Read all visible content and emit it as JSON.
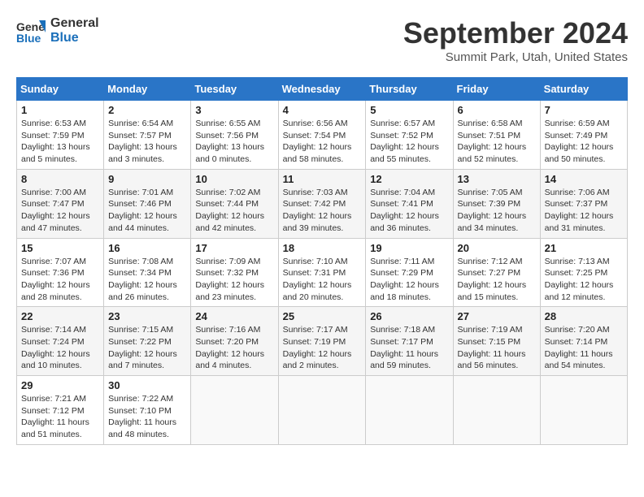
{
  "header": {
    "logo_line1": "General",
    "logo_line2": "Blue",
    "month": "September 2024",
    "location": "Summit Park, Utah, United States"
  },
  "days_of_week": [
    "Sunday",
    "Monday",
    "Tuesday",
    "Wednesday",
    "Thursday",
    "Friday",
    "Saturday"
  ],
  "weeks": [
    [
      {
        "day": "1",
        "info": "Sunrise: 6:53 AM\nSunset: 7:59 PM\nDaylight: 13 hours\nand 5 minutes."
      },
      {
        "day": "2",
        "info": "Sunrise: 6:54 AM\nSunset: 7:57 PM\nDaylight: 13 hours\nand 3 minutes."
      },
      {
        "day": "3",
        "info": "Sunrise: 6:55 AM\nSunset: 7:56 PM\nDaylight: 13 hours\nand 0 minutes."
      },
      {
        "day": "4",
        "info": "Sunrise: 6:56 AM\nSunset: 7:54 PM\nDaylight: 12 hours\nand 58 minutes."
      },
      {
        "day": "5",
        "info": "Sunrise: 6:57 AM\nSunset: 7:52 PM\nDaylight: 12 hours\nand 55 minutes."
      },
      {
        "day": "6",
        "info": "Sunrise: 6:58 AM\nSunset: 7:51 PM\nDaylight: 12 hours\nand 52 minutes."
      },
      {
        "day": "7",
        "info": "Sunrise: 6:59 AM\nSunset: 7:49 PM\nDaylight: 12 hours\nand 50 minutes."
      }
    ],
    [
      {
        "day": "8",
        "info": "Sunrise: 7:00 AM\nSunset: 7:47 PM\nDaylight: 12 hours\nand 47 minutes."
      },
      {
        "day": "9",
        "info": "Sunrise: 7:01 AM\nSunset: 7:46 PM\nDaylight: 12 hours\nand 44 minutes."
      },
      {
        "day": "10",
        "info": "Sunrise: 7:02 AM\nSunset: 7:44 PM\nDaylight: 12 hours\nand 42 minutes."
      },
      {
        "day": "11",
        "info": "Sunrise: 7:03 AM\nSunset: 7:42 PM\nDaylight: 12 hours\nand 39 minutes."
      },
      {
        "day": "12",
        "info": "Sunrise: 7:04 AM\nSunset: 7:41 PM\nDaylight: 12 hours\nand 36 minutes."
      },
      {
        "day": "13",
        "info": "Sunrise: 7:05 AM\nSunset: 7:39 PM\nDaylight: 12 hours\nand 34 minutes."
      },
      {
        "day": "14",
        "info": "Sunrise: 7:06 AM\nSunset: 7:37 PM\nDaylight: 12 hours\nand 31 minutes."
      }
    ],
    [
      {
        "day": "15",
        "info": "Sunrise: 7:07 AM\nSunset: 7:36 PM\nDaylight: 12 hours\nand 28 minutes."
      },
      {
        "day": "16",
        "info": "Sunrise: 7:08 AM\nSunset: 7:34 PM\nDaylight: 12 hours\nand 26 minutes."
      },
      {
        "day": "17",
        "info": "Sunrise: 7:09 AM\nSunset: 7:32 PM\nDaylight: 12 hours\nand 23 minutes."
      },
      {
        "day": "18",
        "info": "Sunrise: 7:10 AM\nSunset: 7:31 PM\nDaylight: 12 hours\nand 20 minutes."
      },
      {
        "day": "19",
        "info": "Sunrise: 7:11 AM\nSunset: 7:29 PM\nDaylight: 12 hours\nand 18 minutes."
      },
      {
        "day": "20",
        "info": "Sunrise: 7:12 AM\nSunset: 7:27 PM\nDaylight: 12 hours\nand 15 minutes."
      },
      {
        "day": "21",
        "info": "Sunrise: 7:13 AM\nSunset: 7:25 PM\nDaylight: 12 hours\nand 12 minutes."
      }
    ],
    [
      {
        "day": "22",
        "info": "Sunrise: 7:14 AM\nSunset: 7:24 PM\nDaylight: 12 hours\nand 10 minutes."
      },
      {
        "day": "23",
        "info": "Sunrise: 7:15 AM\nSunset: 7:22 PM\nDaylight: 12 hours\nand 7 minutes."
      },
      {
        "day": "24",
        "info": "Sunrise: 7:16 AM\nSunset: 7:20 PM\nDaylight: 12 hours\nand 4 minutes."
      },
      {
        "day": "25",
        "info": "Sunrise: 7:17 AM\nSunset: 7:19 PM\nDaylight: 12 hours\nand 2 minutes."
      },
      {
        "day": "26",
        "info": "Sunrise: 7:18 AM\nSunset: 7:17 PM\nDaylight: 11 hours\nand 59 minutes."
      },
      {
        "day": "27",
        "info": "Sunrise: 7:19 AM\nSunset: 7:15 PM\nDaylight: 11 hours\nand 56 minutes."
      },
      {
        "day": "28",
        "info": "Sunrise: 7:20 AM\nSunset: 7:14 PM\nDaylight: 11 hours\nand 54 minutes."
      }
    ],
    [
      {
        "day": "29",
        "info": "Sunrise: 7:21 AM\nSunset: 7:12 PM\nDaylight: 11 hours\nand 51 minutes."
      },
      {
        "day": "30",
        "info": "Sunrise: 7:22 AM\nSunset: 7:10 PM\nDaylight: 11 hours\nand 48 minutes."
      },
      {
        "day": "",
        "info": ""
      },
      {
        "day": "",
        "info": ""
      },
      {
        "day": "",
        "info": ""
      },
      {
        "day": "",
        "info": ""
      },
      {
        "day": "",
        "info": ""
      }
    ]
  ]
}
